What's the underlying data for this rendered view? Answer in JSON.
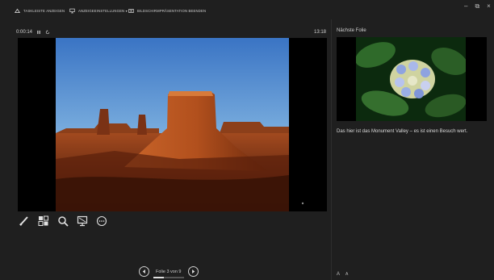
{
  "toolbar": {
    "taskbar_label": "TASKLEISTE ANZEIGEN",
    "display_settings_label": "ANZEIGEEINSTELLUNGEN ▾",
    "end_show_label": "BILDSCHIRMPRÄSENTATION BEENDEN"
  },
  "window": {
    "minimize": "–",
    "restore": "⧉",
    "close": "×"
  },
  "presenter": {
    "elapsed": "0:00:14",
    "clock": "13:18",
    "slide_counter": "Folie 3 von 9",
    "slide_progress": 0.333
  },
  "next_slide": {
    "label": "Nächste Folie",
    "notes": "Das hier ist das Monument Valley – es ist einen Besuch wert."
  },
  "font_controls": {
    "larger": "A",
    "smaller": "A"
  },
  "icons": {
    "taskbar": "taskbar-icon",
    "display_settings": "monitor-settings-icon",
    "end_show": "end-show-icon",
    "pause": "pause-icon",
    "reset": "reset-timer-icon",
    "pen": "pen-icon",
    "all_slides": "all-slides-icon",
    "zoom": "zoom-icon",
    "blackout": "blackout-screen-icon",
    "more": "more-options-icon",
    "prev": "previous-slide-icon",
    "next": "next-slide-icon"
  }
}
